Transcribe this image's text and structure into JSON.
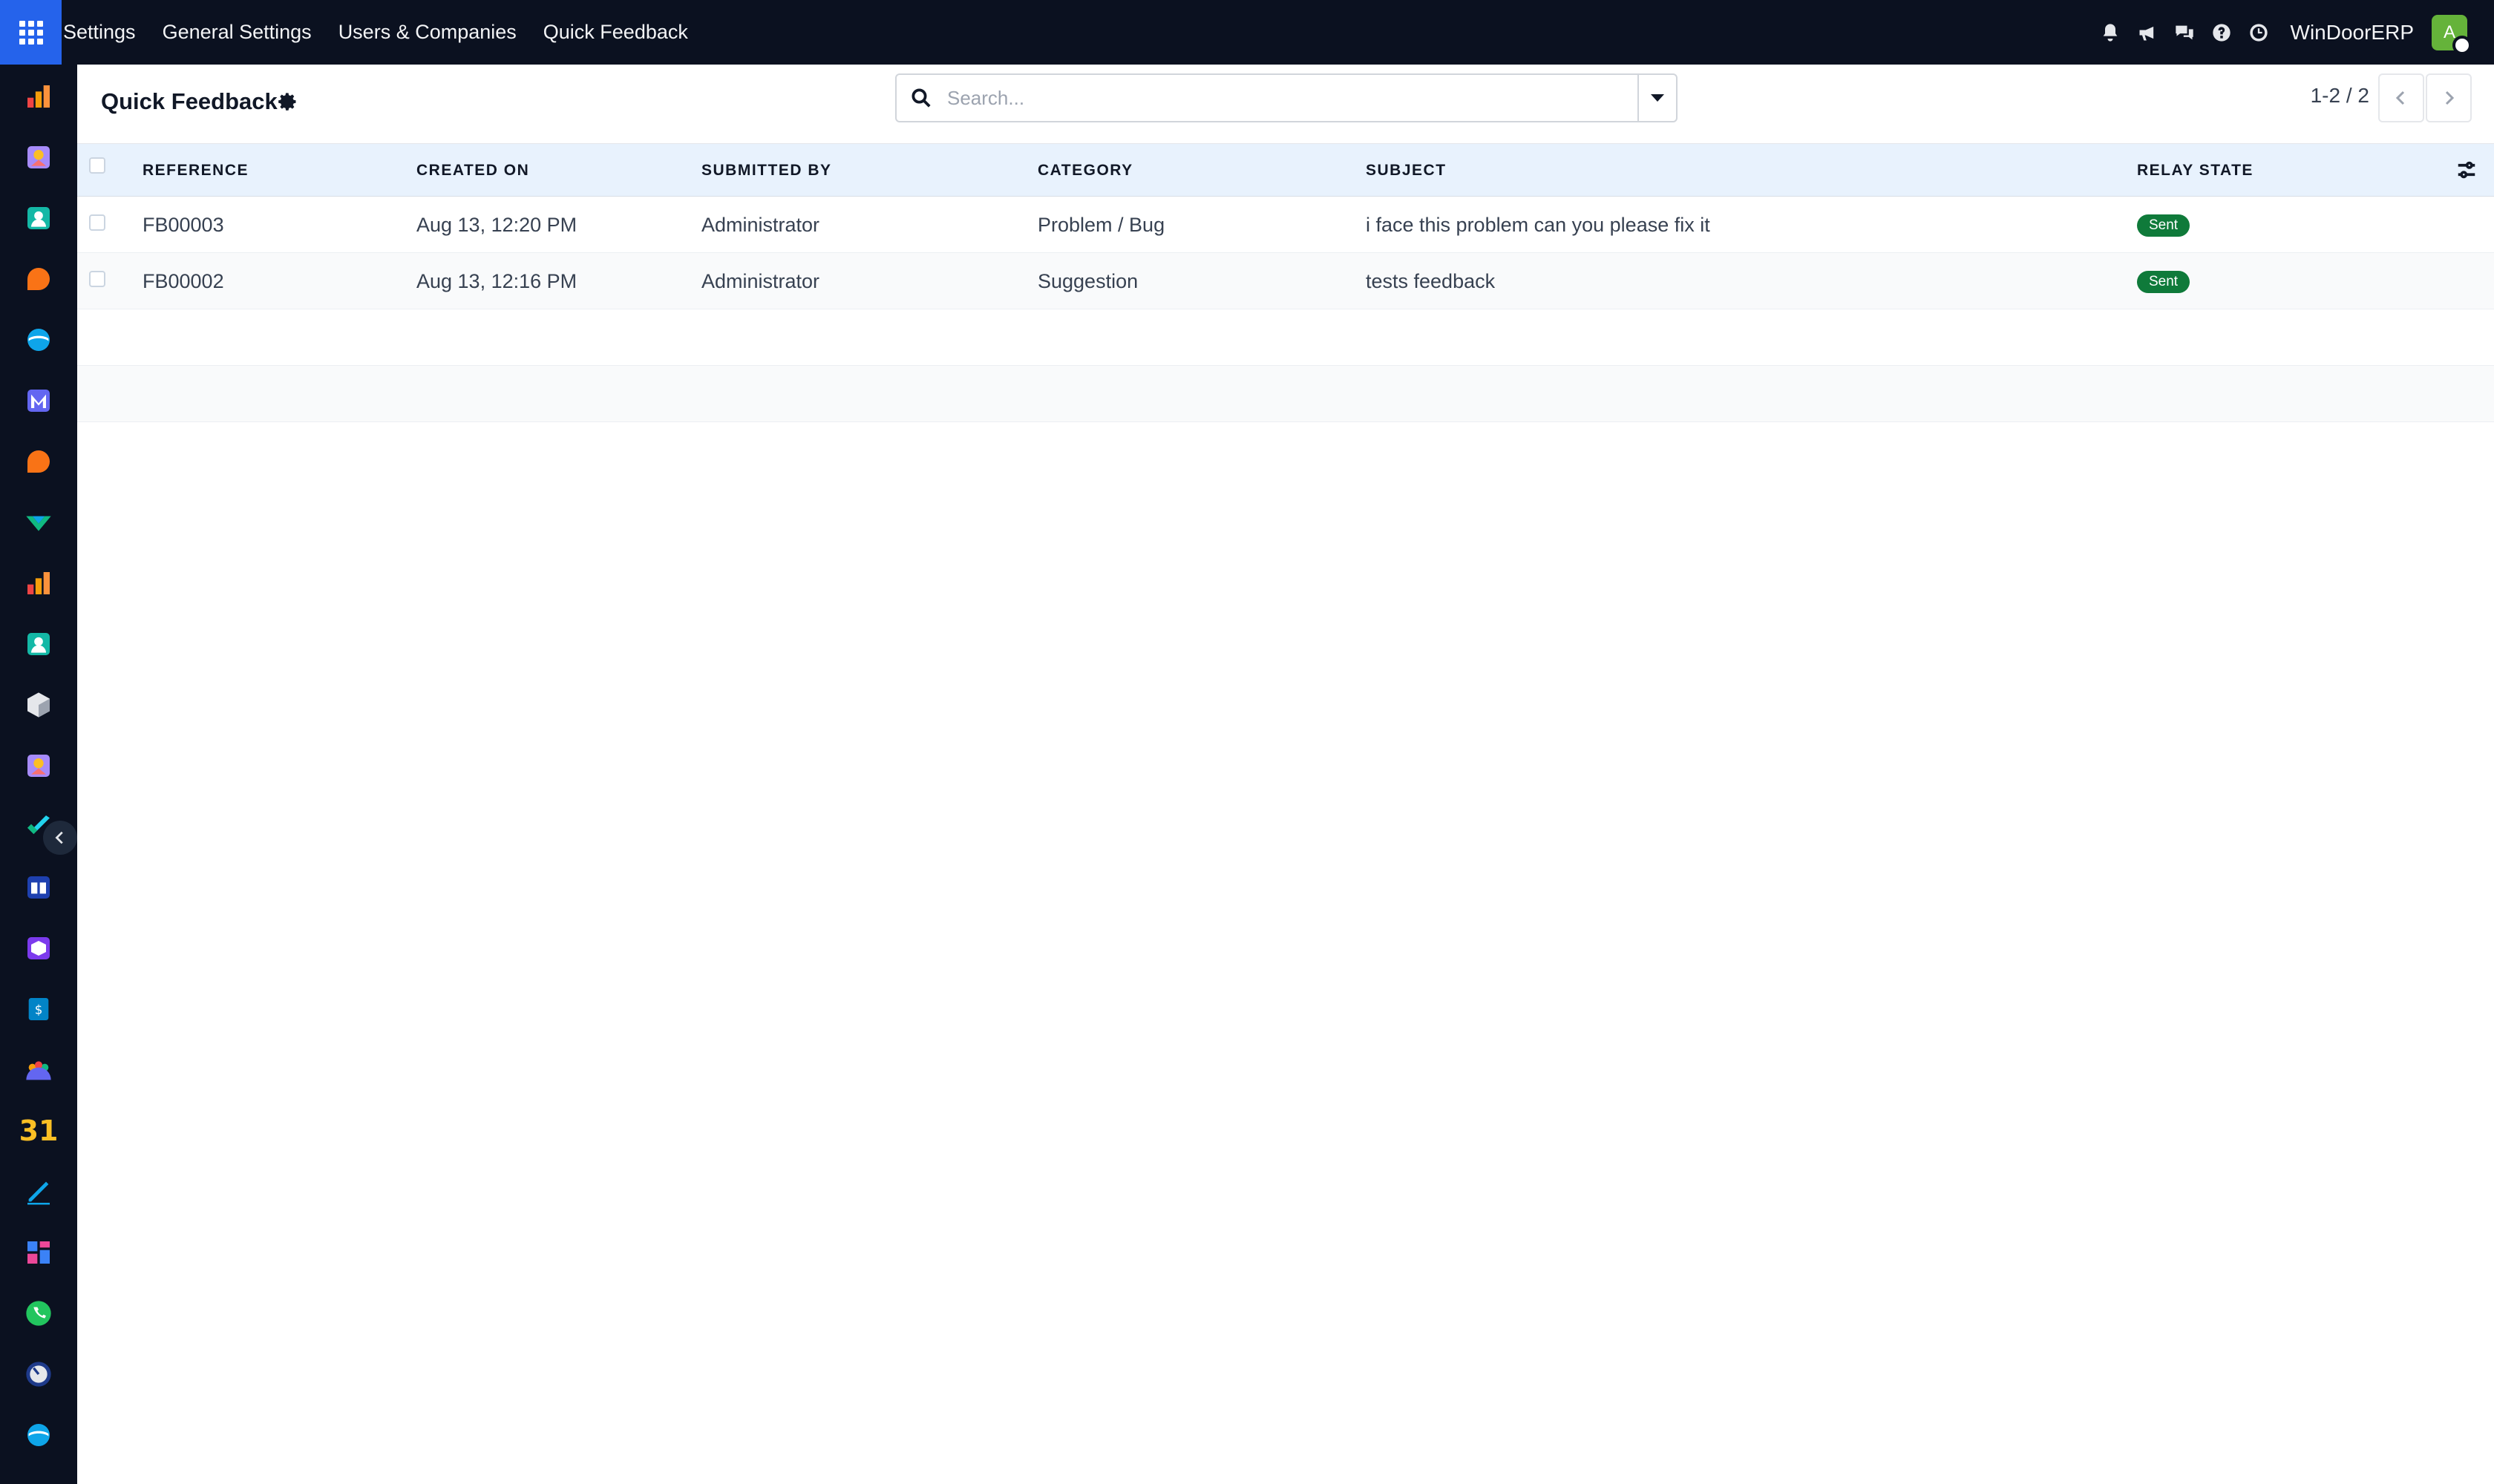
{
  "navbar": {
    "menu": [
      "Settings",
      "General Settings",
      "Users & Companies",
      "Quick Feedback"
    ],
    "company": "WinDoorERP",
    "avatar_initial": "A",
    "icons": [
      "bell-icon",
      "megaphone-icon",
      "chat-icon",
      "help-icon",
      "clock-icon"
    ]
  },
  "sidebar": {
    "apps": [
      "dashboard-app-icon",
      "contacts-app-icon",
      "employees-app-icon",
      "discuss-app-icon",
      "sync-app-icon",
      "mail-app-icon",
      "discuss-app-icon",
      "sales-app-icon",
      "dashboard-app-icon",
      "employees-app-icon",
      "inventory-app-icon",
      "contacts-app-icon",
      "project-app-icon",
      "knowledge-app-icon",
      "products-app-icon",
      "invoicing-app-icon",
      "team-app-icon",
      "calendar-app-icon",
      "sign-app-icon",
      "website-app-icon",
      "whatsapp-app-icon",
      "timer-app-icon",
      "sync-app-icon"
    ],
    "calendar_number": "31"
  },
  "control": {
    "title": "Quick Feedback",
    "search_placeholder": "Search...",
    "pager": "1-2 / 2"
  },
  "table": {
    "headers": {
      "reference": "REFERENCE",
      "created_on": "CREATED ON",
      "submitted_by": "SUBMITTED BY",
      "category": "CATEGORY",
      "subject": "SUBJECT",
      "relay_state": "RELAY STATE"
    },
    "rows": [
      {
        "reference": "FB00003",
        "created_on": "Aug 13, 12:20 PM",
        "submitted_by": "Administrator",
        "category": "Problem / Bug",
        "subject": "i face this problem can you please fix it",
        "relay_state": "Sent"
      },
      {
        "reference": "FB00002",
        "created_on": "Aug 13, 12:16 PM",
        "submitted_by": "Administrator",
        "category": "Suggestion",
        "subject": "tests feedback",
        "relay_state": "Sent"
      }
    ]
  },
  "colors": {
    "navbar_bg": "#0b1120",
    "apps_button": "#2563eb",
    "header_row_bg": "#e8f2fd",
    "badge_sent": "#0f7a3a",
    "avatar": "#65b33a"
  }
}
